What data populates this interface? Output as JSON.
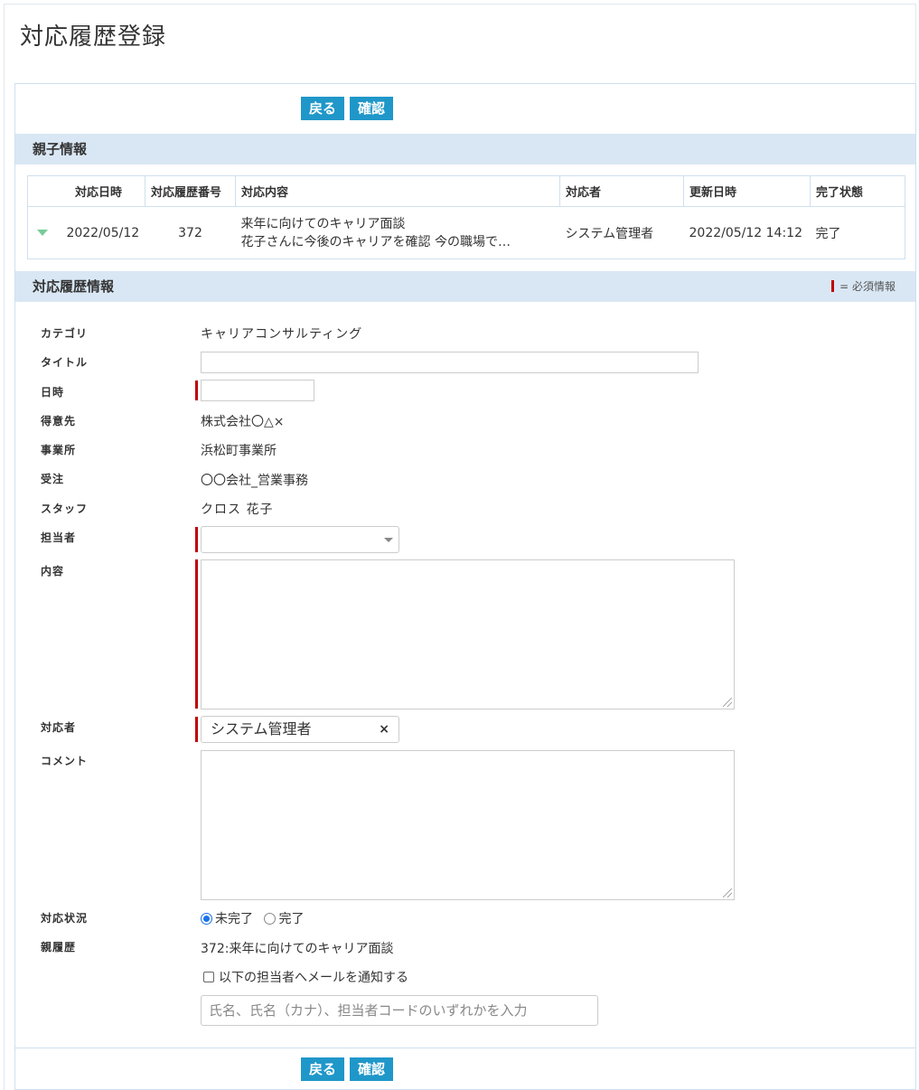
{
  "page": {
    "title": "対応履歴登録"
  },
  "buttons": {
    "back": "戻る",
    "confirm": "確認"
  },
  "parent_section": {
    "title": "親子情報",
    "columns": [
      "対応日時",
      "対応履歴番号",
      "対応内容",
      "対応者",
      "更新日時",
      "完了状態"
    ],
    "row": {
      "date": "2022/05/12",
      "number": "372",
      "content_line1": "来年に向けてのキャリア面談",
      "content_line2": "花子さんに今後のキャリアを確認 今の職場で…",
      "handler": "システム管理者",
      "updated": "2022/05/12 14:12",
      "status": "完了"
    }
  },
  "history_section": {
    "title": "対応履歴情報",
    "required_legend": "= 必須情報"
  },
  "form": {
    "category": {
      "label": "カテゴリ",
      "value": "キャリアコンサルティング"
    },
    "title": {
      "label": "タイトル",
      "value": ""
    },
    "datetime": {
      "label": "日時",
      "value": ""
    },
    "customer": {
      "label": "得意先",
      "value": "株式会社〇△×"
    },
    "office": {
      "label": "事業所",
      "value": "浜松町事業所"
    },
    "order": {
      "label": "受注",
      "value": "〇〇会社_営業事務"
    },
    "staff": {
      "label": "スタッフ",
      "value": "クロス 花子"
    },
    "person_in_charge": {
      "label": "担当者",
      "value": ""
    },
    "content": {
      "label": "内容",
      "value": ""
    },
    "handler": {
      "label": "対応者",
      "value": "システム管理者",
      "remove": "×"
    },
    "comment": {
      "label": "コメント",
      "value": ""
    },
    "status": {
      "label": "対応状況",
      "options": [
        "未完了",
        "完了"
      ],
      "selected": "未完了"
    },
    "parent_history": {
      "label": "親履歴",
      "value": "372:来年に向けてのキャリア面談"
    },
    "notify": {
      "label": "以下の担当者へメールを通知する",
      "checked": false
    },
    "notify_search": {
      "placeholder": "氏名、氏名（カナ）、担当者コードのいずれかを入力"
    }
  },
  "colors": {
    "accent": "#1f97c9",
    "section_bg": "#d9e7f4",
    "required": "#c00000",
    "expand_icon": "#77cc99"
  }
}
